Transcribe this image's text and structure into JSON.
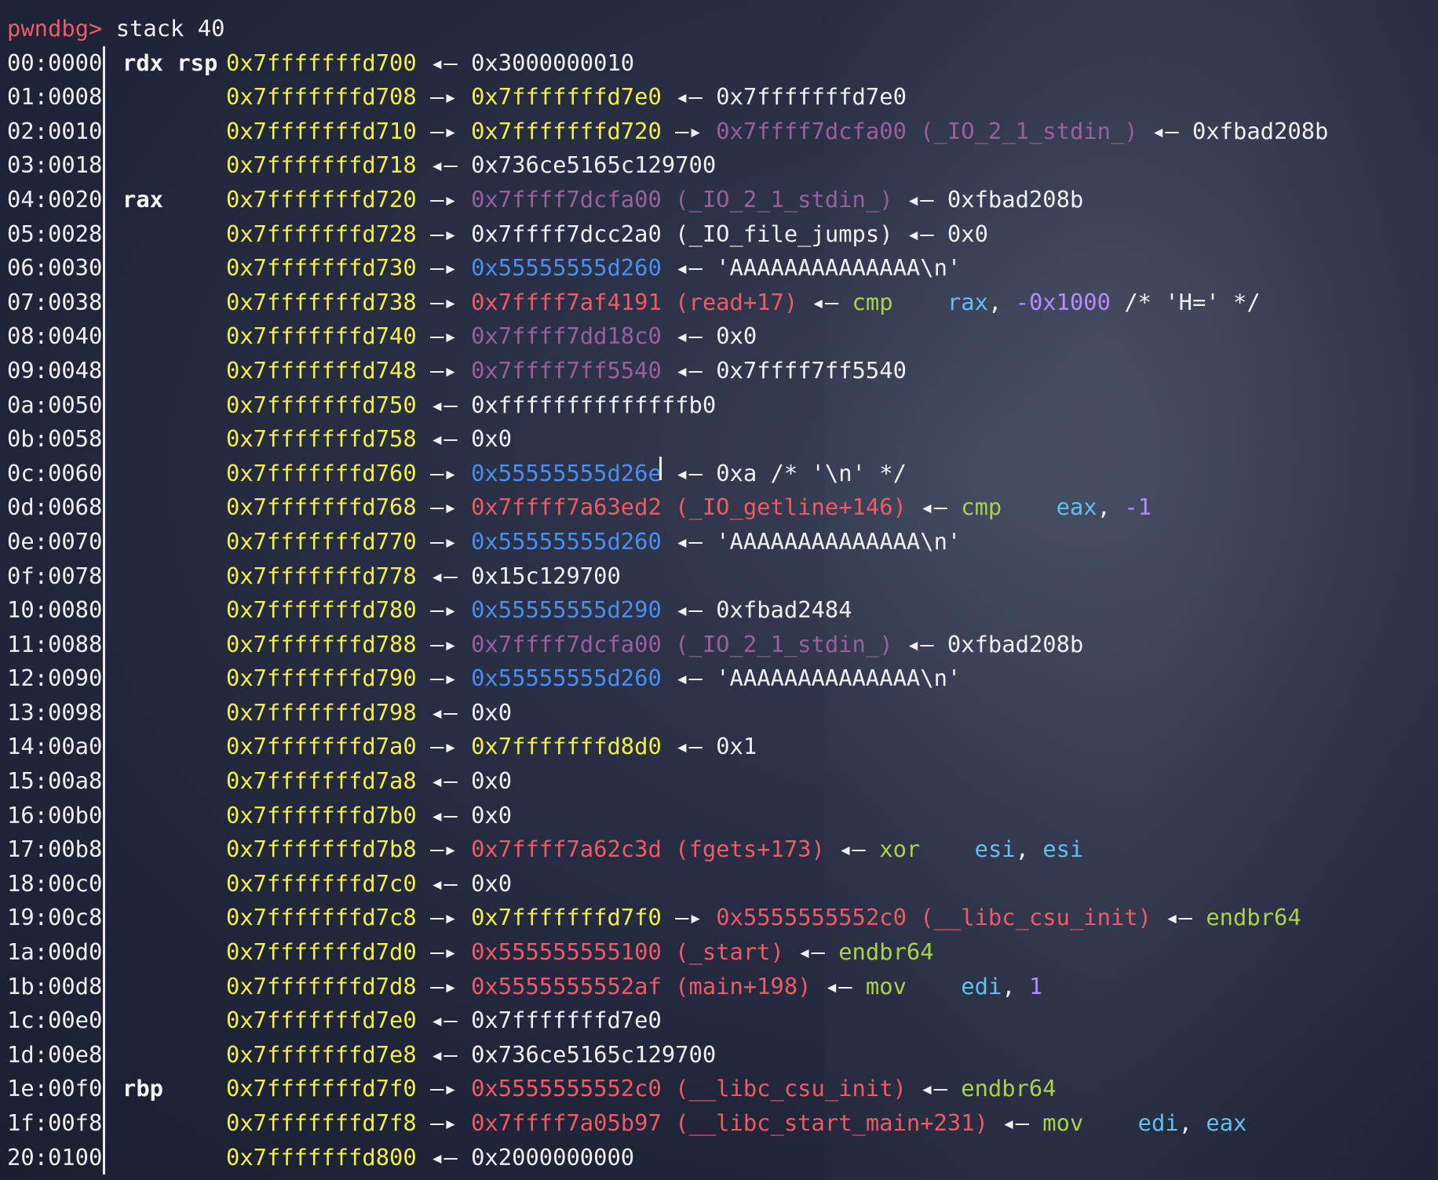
{
  "terminal": {
    "prompt": "pwndbg>",
    "command": " stack 40",
    "colors": {
      "prompt": "#ef5a64",
      "stack_address": "#f2ee4a",
      "code_address": "#ef5a64",
      "data_address": "#9b5fa0",
      "heap_address": "#4a8ff0",
      "mnemonic": "#a8d44a",
      "operand_register": "#5fc0ef",
      "immediate": "#b48cff",
      "plain": "#f0f0f0"
    },
    "rows": [
      {
        "index": "00:0000",
        "regs": "rdx rsp",
        "tokens": [
          {
            "t": "0x7fffffffd700",
            "c": "stack"
          },
          {
            "t": " ◂— ",
            "c": "arrow"
          },
          {
            "t": "0x3000000010",
            "c": "plain"
          }
        ]
      },
      {
        "index": "01:0008",
        "regs": "",
        "tokens": [
          {
            "t": "0x7fffffffd708",
            "c": "stack"
          },
          {
            "t": " —▸ ",
            "c": "arrow"
          },
          {
            "t": "0x7fffffffd7e0",
            "c": "stack"
          },
          {
            "t": " ◂— ",
            "c": "arrow"
          },
          {
            "t": "0x7fffffffd7e0",
            "c": "plain"
          }
        ]
      },
      {
        "index": "02:0010",
        "regs": "",
        "tokens": [
          {
            "t": "0x7fffffffd710",
            "c": "stack"
          },
          {
            "t": " —▸ ",
            "c": "arrow"
          },
          {
            "t": "0x7fffffffd720",
            "c": "stack"
          },
          {
            "t": " —▸ ",
            "c": "arrow"
          },
          {
            "t": "0x7ffff7dcfa00 (_IO_2_1_stdin_)",
            "c": "data"
          },
          {
            "t": " ◂— ",
            "c": "arrow"
          },
          {
            "t": "0xfbad208b",
            "c": "plain"
          }
        ]
      },
      {
        "index": "03:0018",
        "regs": "",
        "tokens": [
          {
            "t": "0x7fffffffd718",
            "c": "stack"
          },
          {
            "t": " ◂— ",
            "c": "arrow"
          },
          {
            "t": "0x736ce5165c129700",
            "c": "plain"
          }
        ]
      },
      {
        "index": "04:0020",
        "regs": "rax",
        "tokens": [
          {
            "t": "0x7fffffffd720",
            "c": "stack"
          },
          {
            "t": " —▸ ",
            "c": "arrow"
          },
          {
            "t": "0x7ffff7dcfa00 (_IO_2_1_stdin_)",
            "c": "data"
          },
          {
            "t": " ◂— ",
            "c": "arrow"
          },
          {
            "t": "0xfbad208b",
            "c": "plain"
          }
        ]
      },
      {
        "index": "05:0028",
        "regs": "",
        "tokens": [
          {
            "t": "0x7fffffffd728",
            "c": "stack"
          },
          {
            "t": " —▸ ",
            "c": "arrow"
          },
          {
            "t": "0x7ffff7dcc2a0 (_IO_file_jumps)",
            "c": "plain"
          },
          {
            "t": " ◂— ",
            "c": "arrow"
          },
          {
            "t": "0x0",
            "c": "plain"
          }
        ]
      },
      {
        "index": "06:0030",
        "regs": "",
        "tokens": [
          {
            "t": "0x7fffffffd730",
            "c": "stack"
          },
          {
            "t": " —▸ ",
            "c": "arrow"
          },
          {
            "t": "0x55555555d260",
            "c": "heap"
          },
          {
            "t": " ◂— ",
            "c": "arrow"
          },
          {
            "t": "'AAAAAAAAAAAAAA\\n'",
            "c": "plain"
          }
        ]
      },
      {
        "index": "07:0038",
        "regs": "",
        "tokens": [
          {
            "t": "0x7fffffffd738",
            "c": "stack"
          },
          {
            "t": " —▸ ",
            "c": "arrow"
          },
          {
            "t": "0x7ffff7af4191 (read+17)",
            "c": "code"
          },
          {
            "t": " ◂— ",
            "c": "arrow"
          },
          {
            "t": "cmp",
            "c": "mnem"
          },
          {
            "t": "    ",
            "c": "plain"
          },
          {
            "t": "rax",
            "c": "opreg"
          },
          {
            "t": ", ",
            "c": "plain"
          },
          {
            "t": "-0x1000",
            "c": "num"
          },
          {
            "t": " /* 'H=' */",
            "c": "plain"
          }
        ]
      },
      {
        "index": "08:0040",
        "regs": "",
        "tokens": [
          {
            "t": "0x7fffffffd740",
            "c": "stack"
          },
          {
            "t": " —▸ ",
            "c": "arrow"
          },
          {
            "t": "0x7ffff7dd18c0",
            "c": "data"
          },
          {
            "t": " ◂— ",
            "c": "arrow"
          },
          {
            "t": "0x0",
            "c": "plain"
          }
        ]
      },
      {
        "index": "09:0048",
        "regs": "",
        "tokens": [
          {
            "t": "0x7fffffffd748",
            "c": "stack"
          },
          {
            "t": " —▸ ",
            "c": "arrow"
          },
          {
            "t": "0x7ffff7ff5540",
            "c": "data"
          },
          {
            "t": " ◂— ",
            "c": "arrow"
          },
          {
            "t": "0x7ffff7ff5540",
            "c": "plain"
          }
        ]
      },
      {
        "index": "0a:0050",
        "regs": "",
        "tokens": [
          {
            "t": "0x7fffffffd750",
            "c": "stack"
          },
          {
            "t": " ◂— ",
            "c": "arrow"
          },
          {
            "t": "0xffffffffffffffb0",
            "c": "plain"
          }
        ]
      },
      {
        "index": "0b:0058",
        "regs": "",
        "tokens": [
          {
            "t": "0x7fffffffd758",
            "c": "stack"
          },
          {
            "t": " ◂— ",
            "c": "arrow"
          },
          {
            "t": "0x0",
            "c": "plain"
          }
        ]
      },
      {
        "index": "0c:0060",
        "regs": "",
        "cursor": true,
        "tokens": [
          {
            "t": "0x7fffffffd760",
            "c": "stack"
          },
          {
            "t": " —▸ ",
            "c": "arrow"
          },
          {
            "t": "0x55555555d26e",
            "c": "heap"
          },
          {
            "t": " ◂— ",
            "c": "arrow"
          },
          {
            "t": "0xa /* '\\n' */",
            "c": "plain"
          }
        ]
      },
      {
        "index": "0d:0068",
        "regs": "",
        "tokens": [
          {
            "t": "0x7fffffffd768",
            "c": "stack"
          },
          {
            "t": " —▸ ",
            "c": "arrow"
          },
          {
            "t": "0x7ffff7a63ed2 (_IO_getline+146)",
            "c": "code"
          },
          {
            "t": " ◂— ",
            "c": "arrow"
          },
          {
            "t": "cmp",
            "c": "mnem"
          },
          {
            "t": "    ",
            "c": "plain"
          },
          {
            "t": "eax",
            "c": "opreg"
          },
          {
            "t": ", ",
            "c": "plain"
          },
          {
            "t": "-1",
            "c": "num"
          }
        ]
      },
      {
        "index": "0e:0070",
        "regs": "",
        "tokens": [
          {
            "t": "0x7fffffffd770",
            "c": "stack"
          },
          {
            "t": " —▸ ",
            "c": "arrow"
          },
          {
            "t": "0x55555555d260",
            "c": "heap"
          },
          {
            "t": " ◂— ",
            "c": "arrow"
          },
          {
            "t": "'AAAAAAAAAAAAAA\\n'",
            "c": "plain"
          }
        ]
      },
      {
        "index": "0f:0078",
        "regs": "",
        "tokens": [
          {
            "t": "0x7fffffffd778",
            "c": "stack"
          },
          {
            "t": " ◂— ",
            "c": "arrow"
          },
          {
            "t": "0x15c129700",
            "c": "plain"
          }
        ]
      },
      {
        "index": "10:0080",
        "regs": "",
        "tokens": [
          {
            "t": "0x7fffffffd780",
            "c": "stack"
          },
          {
            "t": " —▸ ",
            "c": "arrow"
          },
          {
            "t": "0x55555555d290",
            "c": "heap"
          },
          {
            "t": " ◂— ",
            "c": "arrow"
          },
          {
            "t": "0xfbad2484",
            "c": "plain"
          }
        ]
      },
      {
        "index": "11:0088",
        "regs": "",
        "tokens": [
          {
            "t": "0x7fffffffd788",
            "c": "stack"
          },
          {
            "t": " —▸ ",
            "c": "arrow"
          },
          {
            "t": "0x7ffff7dcfa00 (_IO_2_1_stdin_)",
            "c": "data"
          },
          {
            "t": " ◂— ",
            "c": "arrow"
          },
          {
            "t": "0xfbad208b",
            "c": "plain"
          }
        ]
      },
      {
        "index": "12:0090",
        "regs": "",
        "tokens": [
          {
            "t": "0x7fffffffd790",
            "c": "stack"
          },
          {
            "t": " —▸ ",
            "c": "arrow"
          },
          {
            "t": "0x55555555d260",
            "c": "heap"
          },
          {
            "t": " ◂— ",
            "c": "arrow"
          },
          {
            "t": "'AAAAAAAAAAAAAA\\n'",
            "c": "plain"
          }
        ]
      },
      {
        "index": "13:0098",
        "regs": "",
        "tokens": [
          {
            "t": "0x7fffffffd798",
            "c": "stack"
          },
          {
            "t": " ◂— ",
            "c": "arrow"
          },
          {
            "t": "0x0",
            "c": "plain"
          }
        ]
      },
      {
        "index": "14:00a0",
        "regs": "",
        "tokens": [
          {
            "t": "0x7fffffffd7a0",
            "c": "stack"
          },
          {
            "t": " —▸ ",
            "c": "arrow"
          },
          {
            "t": "0x7fffffffd8d0",
            "c": "stack"
          },
          {
            "t": " ◂— ",
            "c": "arrow"
          },
          {
            "t": "0x1",
            "c": "plain"
          }
        ]
      },
      {
        "index": "15:00a8",
        "regs": "",
        "tokens": [
          {
            "t": "0x7fffffffd7a8",
            "c": "stack"
          },
          {
            "t": " ◂— ",
            "c": "arrow"
          },
          {
            "t": "0x0",
            "c": "plain"
          }
        ]
      },
      {
        "index": "16:00b0",
        "regs": "",
        "tokens": [
          {
            "t": "0x7fffffffd7b0",
            "c": "stack"
          },
          {
            "t": " ◂— ",
            "c": "arrow"
          },
          {
            "t": "0x0",
            "c": "plain"
          }
        ]
      },
      {
        "index": "17:00b8",
        "regs": "",
        "tokens": [
          {
            "t": "0x7fffffffd7b8",
            "c": "stack"
          },
          {
            "t": " —▸ ",
            "c": "arrow"
          },
          {
            "t": "0x7ffff7a62c3d (fgets+173)",
            "c": "code"
          },
          {
            "t": " ◂— ",
            "c": "arrow"
          },
          {
            "t": "xor",
            "c": "mnem"
          },
          {
            "t": "    ",
            "c": "plain"
          },
          {
            "t": "esi",
            "c": "opreg"
          },
          {
            "t": ", ",
            "c": "plain"
          },
          {
            "t": "esi",
            "c": "opreg"
          }
        ]
      },
      {
        "index": "18:00c0",
        "regs": "",
        "tokens": [
          {
            "t": "0x7fffffffd7c0",
            "c": "stack"
          },
          {
            "t": " ◂— ",
            "c": "arrow"
          },
          {
            "t": "0x0",
            "c": "plain"
          }
        ]
      },
      {
        "index": "19:00c8",
        "regs": "",
        "tokens": [
          {
            "t": "0x7fffffffd7c8",
            "c": "stack"
          },
          {
            "t": " —▸ ",
            "c": "arrow"
          },
          {
            "t": "0x7fffffffd7f0",
            "c": "stack"
          },
          {
            "t": " —▸ ",
            "c": "arrow"
          },
          {
            "t": "0x5555555552c0 (__libc_csu_init)",
            "c": "code"
          },
          {
            "t": " ◂— ",
            "c": "arrow"
          },
          {
            "t": "endbr64",
            "c": "mnem"
          }
        ]
      },
      {
        "index": "1a:00d0",
        "regs": "",
        "tokens": [
          {
            "t": "0x7fffffffd7d0",
            "c": "stack"
          },
          {
            "t": " —▸ ",
            "c": "arrow"
          },
          {
            "t": "0x555555555100 (_start)",
            "c": "code"
          },
          {
            "t": " ◂— ",
            "c": "arrow"
          },
          {
            "t": "endbr64",
            "c": "mnem"
          }
        ]
      },
      {
        "index": "1b:00d8",
        "regs": "",
        "tokens": [
          {
            "t": "0x7fffffffd7d8",
            "c": "stack"
          },
          {
            "t": " —▸ ",
            "c": "arrow"
          },
          {
            "t": "0x5555555552af (main+198)",
            "c": "code"
          },
          {
            "t": " ◂— ",
            "c": "arrow"
          },
          {
            "t": "mov",
            "c": "mnem"
          },
          {
            "t": "    ",
            "c": "plain"
          },
          {
            "t": "edi",
            "c": "opreg"
          },
          {
            "t": ", ",
            "c": "plain"
          },
          {
            "t": "1",
            "c": "num"
          }
        ]
      },
      {
        "index": "1c:00e0",
        "regs": "",
        "tokens": [
          {
            "t": "0x7fffffffd7e0",
            "c": "stack"
          },
          {
            "t": " ◂— ",
            "c": "arrow"
          },
          {
            "t": "0x7fffffffd7e0",
            "c": "plain"
          }
        ]
      },
      {
        "index": "1d:00e8",
        "regs": "",
        "tokens": [
          {
            "t": "0x7fffffffd7e8",
            "c": "stack"
          },
          {
            "t": " ◂— ",
            "c": "arrow"
          },
          {
            "t": "0x736ce5165c129700",
            "c": "plain"
          }
        ]
      },
      {
        "index": "1e:00f0",
        "regs": "rbp",
        "tokens": [
          {
            "t": "0x7fffffffd7f0",
            "c": "stack"
          },
          {
            "t": " —▸ ",
            "c": "arrow"
          },
          {
            "t": "0x5555555552c0 (__libc_csu_init)",
            "c": "code"
          },
          {
            "t": " ◂— ",
            "c": "arrow"
          },
          {
            "t": "endbr64",
            "c": "mnem"
          }
        ]
      },
      {
        "index": "1f:00f8",
        "regs": "",
        "tokens": [
          {
            "t": "0x7fffffffd7f8",
            "c": "stack"
          },
          {
            "t": " —▸ ",
            "c": "arrow"
          },
          {
            "t": "0x7ffff7a05b97 (__libc_start_main+231)",
            "c": "code"
          },
          {
            "t": " ◂— ",
            "c": "arrow"
          },
          {
            "t": "mov",
            "c": "mnem"
          },
          {
            "t": "    ",
            "c": "plain"
          },
          {
            "t": "edi",
            "c": "opreg"
          },
          {
            "t": ", ",
            "c": "plain"
          },
          {
            "t": "eax",
            "c": "opreg"
          }
        ]
      },
      {
        "index": "20:0100",
        "regs": "",
        "tokens": [
          {
            "t": "0x7fffffffd800",
            "c": "stack"
          },
          {
            "t": " ◂— ",
            "c": "arrow"
          },
          {
            "t": "0x2000000000",
            "c": "plain"
          }
        ]
      }
    ]
  }
}
